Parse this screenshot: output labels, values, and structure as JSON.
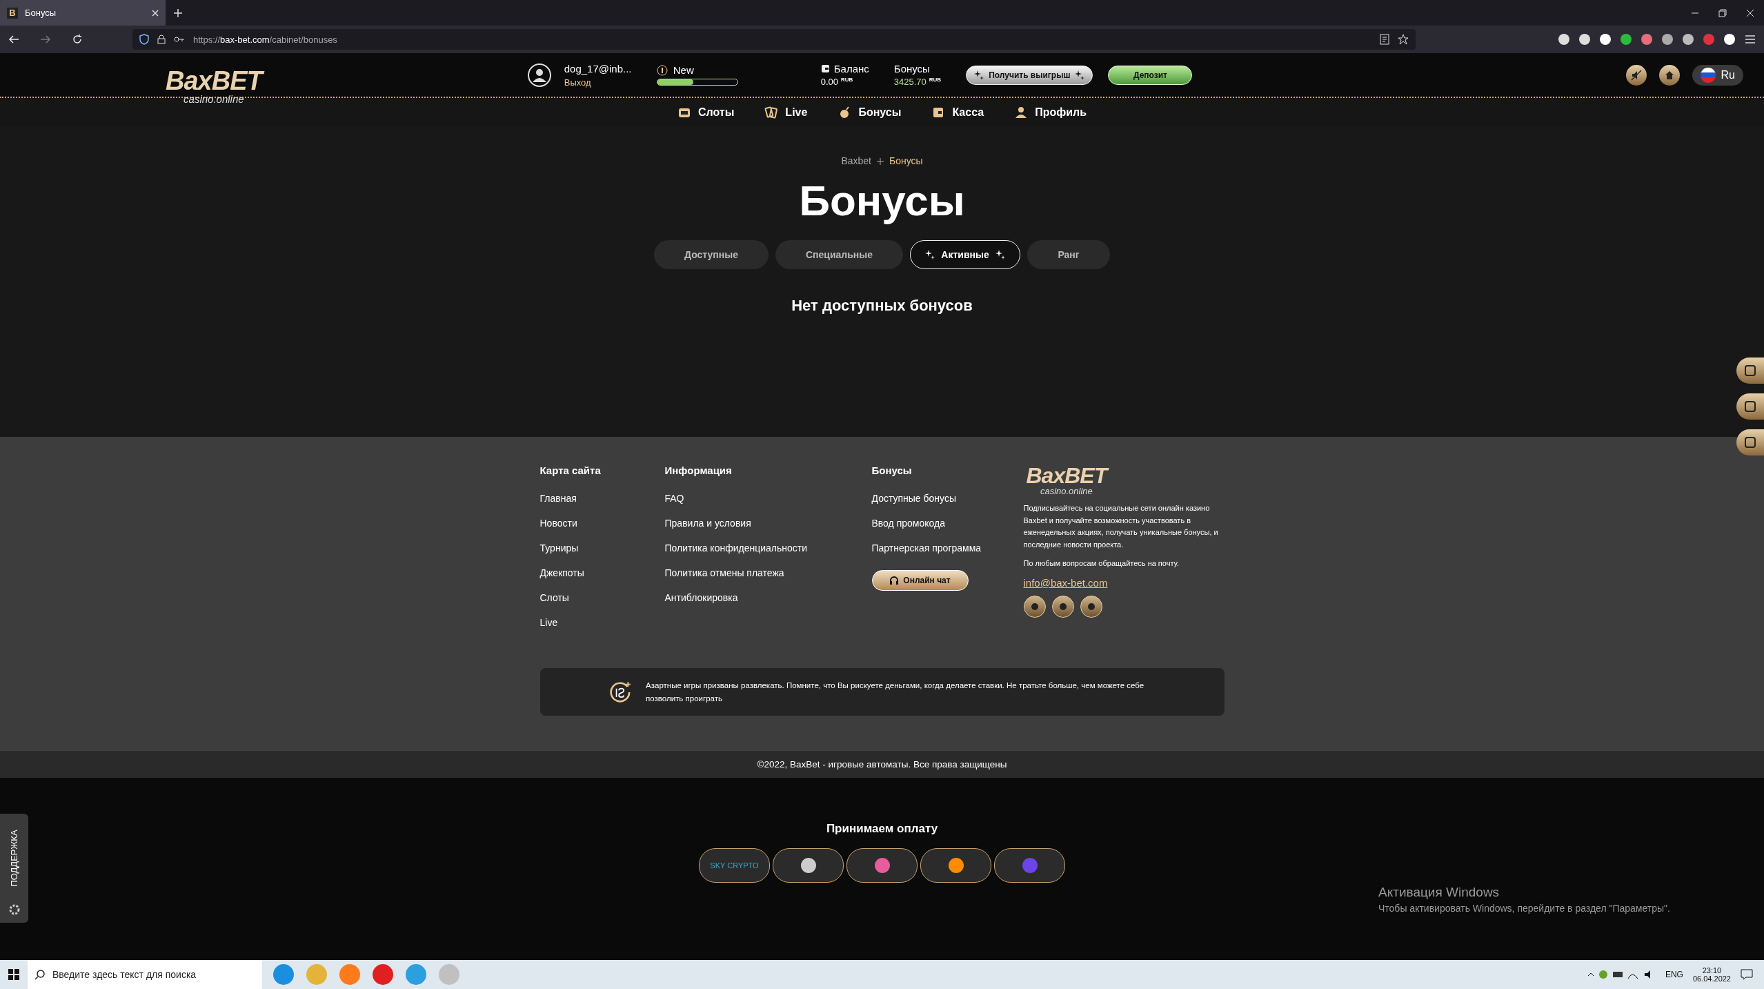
{
  "browser": {
    "favicon": "B",
    "tab_title": "Бонусы",
    "url_scheme": "https://",
    "url_host": "bax-bet.com",
    "url_path": "/cabinet/bonuses"
  },
  "header": {
    "logo": {
      "brand": "BaxBET",
      "tagline": "casino.online"
    },
    "user": {
      "email": "dog_17@inb...",
      "logout": "Выход"
    },
    "rank": {
      "label": "New",
      "level": 0.45
    },
    "balance": {
      "label": "Баланс",
      "amount": "0.00",
      "currency": "RUB"
    },
    "bonuses": {
      "label": "Бонусы",
      "amount": "3425.70",
      "currency": "RUB"
    },
    "withdraw_button": "Получить выигрыш",
    "deposit_button": "Депозит",
    "language": "Ru"
  },
  "nav": [
    {
      "label": "Слоты"
    },
    {
      "label": "Live"
    },
    {
      "label": "Бонусы"
    },
    {
      "label": "Касса"
    },
    {
      "label": "Профиль"
    }
  ],
  "breadcrumb": [
    "Baxbet",
    "Бонусы"
  ],
  "title": "Бонусы",
  "tabs": [
    {
      "label": "Доступные",
      "selected": false
    },
    {
      "label": "Специальные",
      "selected": false
    },
    {
      "label": "Активные",
      "selected": true
    },
    {
      "label": "Ранг",
      "selected": false
    }
  ],
  "empty_message": "Нет доступных бонусов",
  "footer": {
    "columns": [
      {
        "heading": "Карта сайта",
        "links": [
          "Главная",
          "Новости",
          "Турниры",
          "Джекпоты",
          "Слоты",
          "Live"
        ]
      },
      {
        "heading": "Информация",
        "links": [
          "FAQ",
          "Правила и условия",
          "Политика конфиденциальности",
          "Политика отмены платежа",
          "Антиблокировка"
        ]
      },
      {
        "heading": "Бонусы",
        "links": [
          "Доступные бонусы",
          "Ввод промокода",
          "Партнерская программа"
        ],
        "chat_button": "Онлайн чат"
      }
    ],
    "logo": {
      "brand": "BaxBET",
      "tagline": "casino.online"
    },
    "about": [
      "Подписывайтесь на социальные сети онлайн казино Baxbet и получайте возможность участвовать в еженедельных акциях, получать уникальные бонусы, и последние новости проекта.",
      "По любым вопросам обращайтесь на почту."
    ],
    "email": "info@bax-bet.com",
    "disclaimer": "Азартные игры призваны развлекать. Помните, что Вы рискуете деньгами, когда делаете ставки. Не тратьте больше, чем можете себе позволить проиграть"
  },
  "copyright": "©2022, BaxBet - игровые автоматы. Все права защищены",
  "payments": {
    "heading": "Принимаем оплату",
    "crypto_label": "SKY CRYPTO"
  },
  "support_tab": "ПОДДЕРЖКА",
  "os_notice": {
    "title": "Активация Windows",
    "text": "Чтобы активировать Windows, перейдите в раздел \"Параметры\"."
  },
  "taskbar": {
    "search_placeholder": "Введите здесь текст для поиска",
    "language": "ENG",
    "time": "23:10",
    "date": "06.04.2022"
  }
}
